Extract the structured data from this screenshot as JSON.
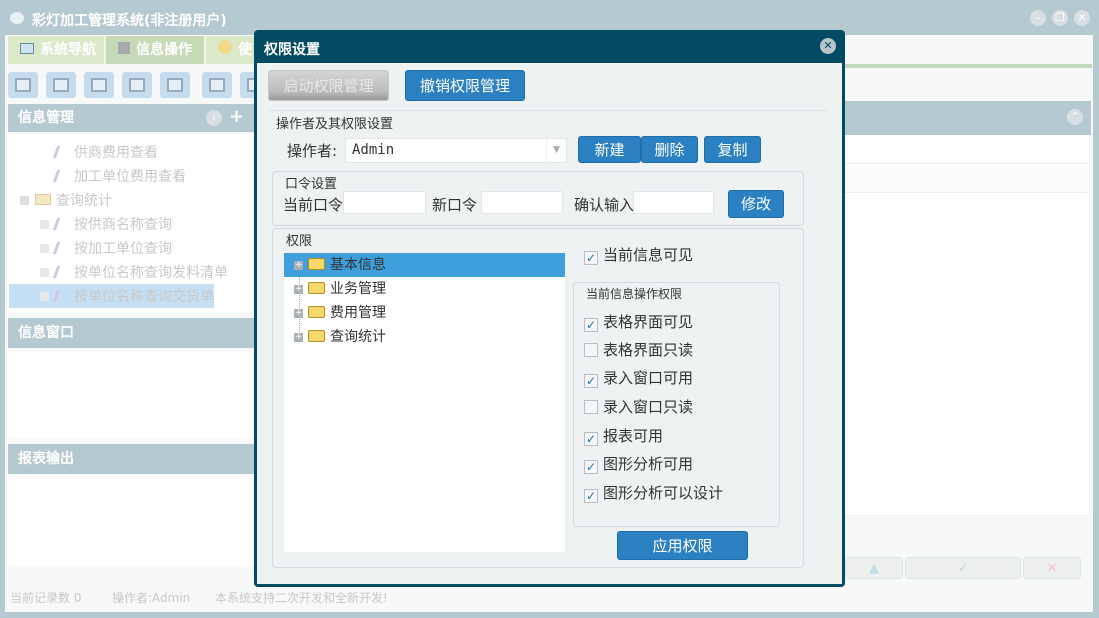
{
  "app": {
    "title": "彩灯加工管理系统(非注册用户)"
  },
  "tabs": [
    {
      "label": "系统导航"
    },
    {
      "label": "信息操作"
    },
    {
      "label": "使"
    }
  ],
  "left": {
    "info_mgmt": "信息管理",
    "tree": [
      "供商费用查看",
      "加工单位费用查看",
      "查询统计",
      "按供商名称查询",
      "按加工单位查询",
      "按单位名称查询发料清单",
      "按单位名称查询交货单"
    ],
    "info_window": "信息窗口",
    "report": "报表输出"
  },
  "status": {
    "records": "当前记录数 0",
    "operator": "操作者:Admin",
    "note": "本系统支持二次开发和全新开发!"
  },
  "dialog": {
    "title": "权限设置",
    "enable_btn": "启动权限管理",
    "revoke_btn": "撤销权限管理",
    "operator_section": "操作者及其权限设置",
    "operator_label": "操作者:",
    "operator_value": "Admin",
    "new_btn": "新建",
    "delete_btn": "删除",
    "copy_btn": "复制",
    "pwd_section": "口令设置",
    "current_pwd": "当前口令",
    "new_pwd": "新口令",
    "confirm_pwd": "确认输入",
    "modify_btn": "修改",
    "perm_section": "权限",
    "perm_tree": [
      "基本信息",
      "业务管理",
      "费用管理",
      "查询统计"
    ],
    "visible_label": "当前信息可见",
    "visible_checked": true,
    "ops_section": "当前信息操作权限",
    "ops": [
      {
        "label": "表格界面可见",
        "checked": true
      },
      {
        "label": "表格界面只读",
        "checked": false
      },
      {
        "label": "录入窗口可用",
        "checked": true
      },
      {
        "label": "录入窗口只读",
        "checked": false
      },
      {
        "label": "报表可用",
        "checked": true
      },
      {
        "label": "图形分析可用",
        "checked": true
      },
      {
        "label": "图形分析可以设计",
        "checked": true
      }
    ],
    "apply_btn": "应用权限"
  },
  "colors": {
    "dialog_frame": "#034a63",
    "accent": "#2a80c0",
    "selection": "#3f9fdc"
  }
}
